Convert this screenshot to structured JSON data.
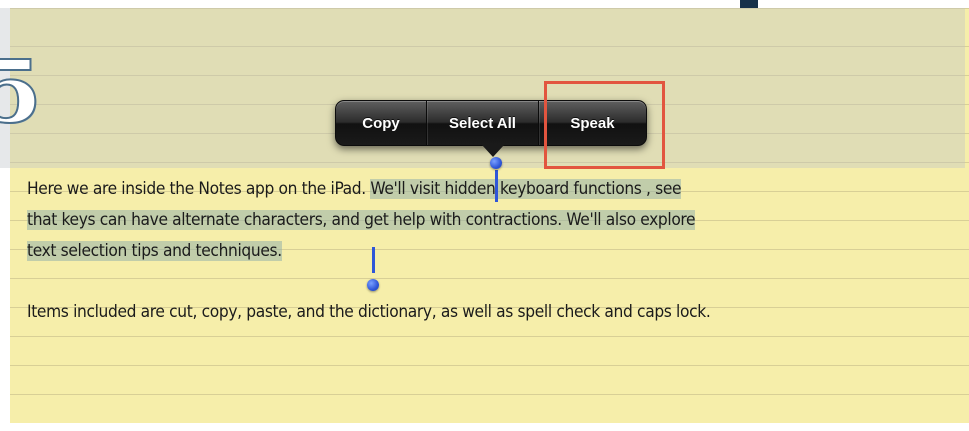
{
  "popover_menu": {
    "copy_label": "Copy",
    "select_all_label": "Select All",
    "speak_label": "Speak"
  },
  "note": {
    "paragraph1": {
      "line1_plain": "Here we are inside the Notes app on the iPad. ",
      "line1_selected": "We'll visit hidden keyboard functions , see",
      "line2_selected": "that keys can  have alternate characters, and get help with contractions. We'll also explore",
      "line3_selected": "text selection tips and techniques."
    },
    "paragraph2": "Items included are cut, copy, paste, and the dictionary, as well as spell check and caps lock."
  },
  "colors": {
    "paper": "#f6eeaa",
    "rule_line": "#d8cf96",
    "selection": "#96b2aa",
    "handle": "#2f56d8",
    "highlight_box": "#e2553f",
    "slide_frame": "#17314a"
  },
  "icons": {
    "selection_handles": "blue-dot-handle",
    "edge_glyph": "decorative-partial-title-letter"
  }
}
